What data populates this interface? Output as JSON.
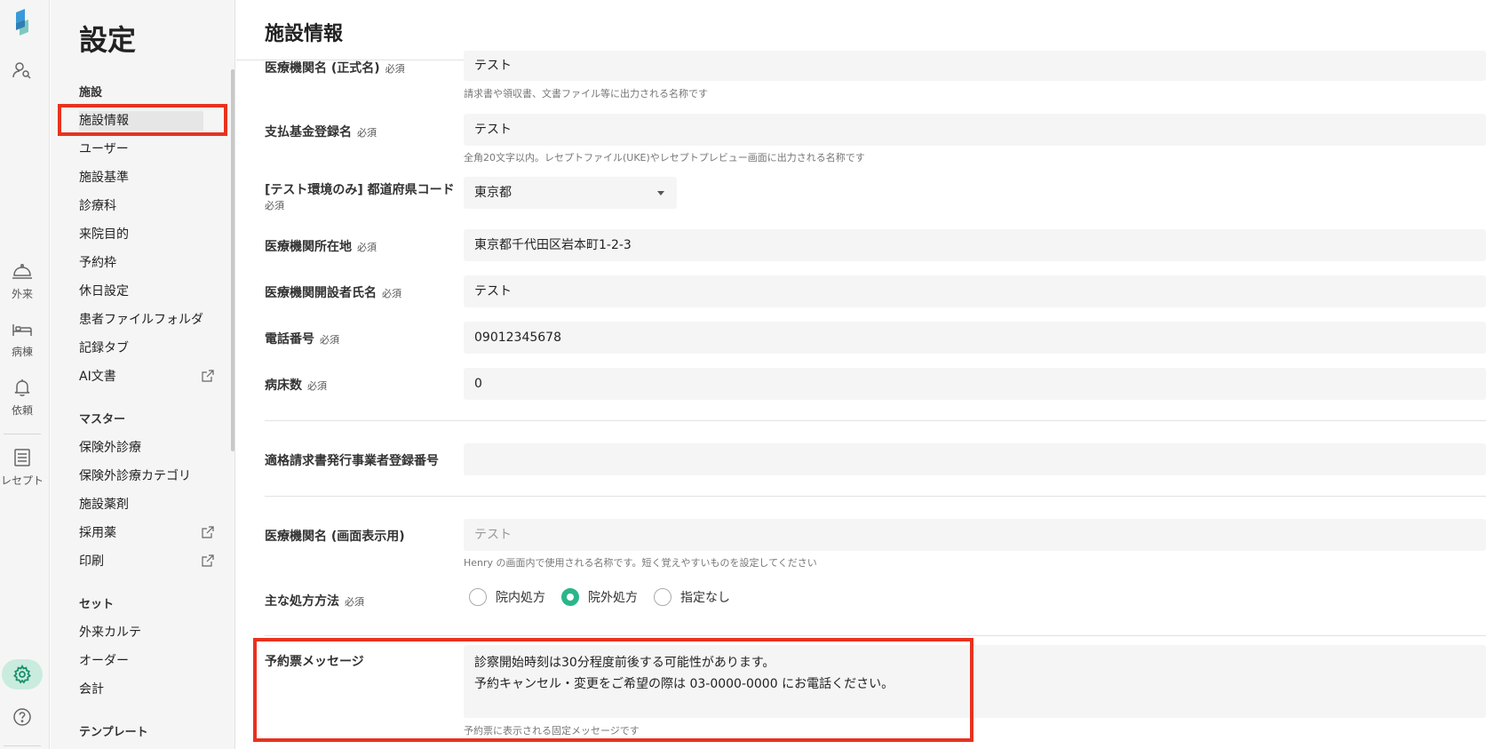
{
  "rail": {
    "items": [
      {
        "label": "",
        "icon": "user-search-icon"
      },
      {
        "label": "外来",
        "icon": "bell-tray-icon"
      },
      {
        "label": "病棟",
        "icon": "bed-icon"
      },
      {
        "label": "依頼",
        "icon": "bell-icon"
      },
      {
        "label": "レセプト",
        "icon": "document-list-icon"
      }
    ],
    "active_color": "#c9ecdf"
  },
  "sidebar": {
    "title": "設定",
    "sections": [
      {
        "title": "施設",
        "items": [
          "施設情報",
          "ユーザー",
          "施設基準",
          "診療科",
          "来院目的",
          "予約枠",
          "休日設定",
          "患者ファイルフォルダ",
          "記録タブ",
          "AI文書"
        ]
      },
      {
        "title": "マスター",
        "items": [
          "保険外診療",
          "保険外診療カテゴリ",
          "施設薬剤",
          "採用薬",
          "印刷"
        ]
      },
      {
        "title": "セット",
        "items": [
          "外来カルテ",
          "オーダー",
          "会計"
        ]
      },
      {
        "title": "テンプレート",
        "items": []
      }
    ],
    "active_item": "施設情報"
  },
  "main": {
    "title": "施設情報",
    "required_tag": "必須",
    "fields": {
      "official_name": {
        "label": "医療機関名 (正式名)",
        "value": "テスト",
        "hint": "請求書や領収書、文書ファイル等に出力される名称です"
      },
      "fund_name": {
        "label": "支払基金登録名",
        "value": "テスト",
        "hint": "全角20文字以内。レセプトファイル(UKE)やレセプトプレビュー画面に出力される名称です"
      },
      "prefecture": {
        "label": "[テスト環境のみ] 都道府県コード",
        "value": "東京都"
      },
      "address": {
        "label": "医療機関所在地",
        "value": "東京都千代田区岩本町1-2-3"
      },
      "founder": {
        "label": "医療機関開設者氏名",
        "value": "テスト"
      },
      "phone": {
        "label": "電話番号",
        "value": "09012345678"
      },
      "beds": {
        "label": "病床数",
        "value": "0"
      },
      "invoice_no": {
        "label": "適格請求書発行事業者登録番号",
        "value": ""
      },
      "display_name": {
        "label": "医療機関名 (画面表示用)",
        "placeholder": "テスト",
        "hint": "Henry の画面内で使用される名称です。短く覚えやすいものを設定してください"
      },
      "prescription": {
        "label": "主な処方方法",
        "options": [
          "院内処方",
          "院外処方",
          "指定なし"
        ],
        "selected": "院外処方"
      },
      "ticket_message": {
        "label": "予約票メッセージ",
        "lines": [
          "診察開始時刻は30分程度前後する可能性があります。",
          "予約キャンセル・変更をご希望の際は 03-0000-0000 にお電話ください。"
        ],
        "hint": "予約票に表示される固定メッセージです"
      }
    }
  },
  "colors": {
    "highlight": "#e8321e",
    "accent": "#2bb58a"
  }
}
